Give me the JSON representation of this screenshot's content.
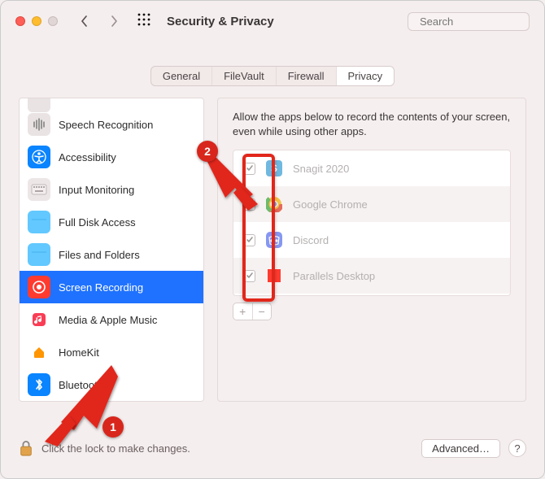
{
  "window": {
    "title": "Security & Privacy",
    "searchPlaceholder": "Search"
  },
  "tabs": [
    {
      "label": "General",
      "active": false
    },
    {
      "label": "FileVault",
      "active": false
    },
    {
      "label": "Firewall",
      "active": false
    },
    {
      "label": "Privacy",
      "active": true
    }
  ],
  "sidebar": {
    "items": [
      {
        "label": "Speech Recognition",
        "iconBg": "#e9e3e3",
        "glyph": "siri"
      },
      {
        "label": "Accessibility",
        "iconBg": "#0a84ff",
        "glyph": "access"
      },
      {
        "label": "Input Monitoring",
        "iconBg": "#ece6e6",
        "glyph": "keyboard"
      },
      {
        "label": "Full Disk Access",
        "iconBg": "#62c8ff",
        "glyph": "folder"
      },
      {
        "label": "Files and Folders",
        "iconBg": "#62c8ff",
        "glyph": "folder"
      },
      {
        "label": "Screen Recording",
        "iconBg": "#ff3b30",
        "glyph": "target",
        "selected": true
      },
      {
        "label": "Media & Apple Music",
        "iconBg": "#ffffff",
        "glyph": "music"
      },
      {
        "label": "HomeKit",
        "iconBg": "#ffffff",
        "glyph": "home"
      },
      {
        "label": "Bluetooth",
        "iconBg": "#0a84ff",
        "glyph": "bt"
      }
    ]
  },
  "rightPane": {
    "description": "Allow the apps below to record the contents of your screen, even while using other apps.",
    "apps": [
      {
        "name": "Snagit 2020",
        "checked": true,
        "iconBg": "#6fb8e0",
        "glyph": "S"
      },
      {
        "name": "Google Chrome",
        "checked": false,
        "iconBg": "#ffffff",
        "glyph": "chrome"
      },
      {
        "name": "Discord",
        "checked": true,
        "iconBg": "#8697f2",
        "glyph": "discord"
      },
      {
        "name": "Parallels Desktop",
        "checked": true,
        "iconBg": "#ff3b30",
        "glyph": "parallels"
      }
    ],
    "addLabel": "+",
    "removeLabel": "−"
  },
  "footer": {
    "lockText": "Click the lock to make changes.",
    "advancedLabel": "Advanced…",
    "helpLabel": "?"
  },
  "annotations": {
    "badge1": "1",
    "badge2": "2"
  }
}
